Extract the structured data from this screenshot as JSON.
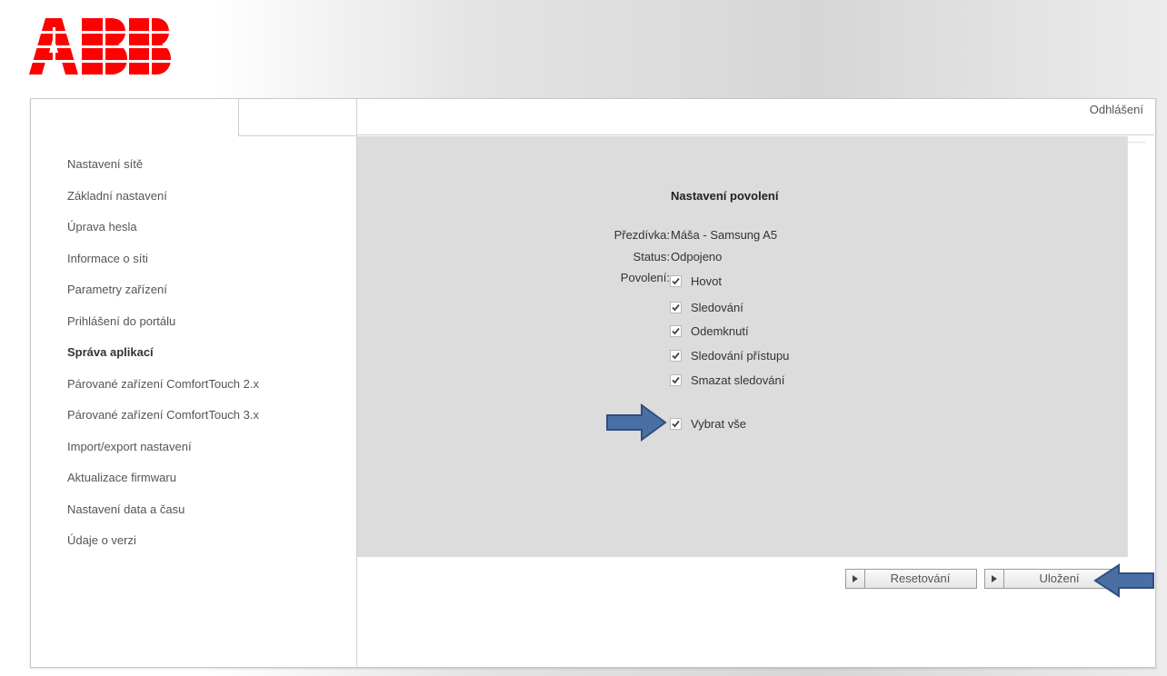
{
  "brand": {
    "logo_text": "ABB",
    "color": "#ff0000"
  },
  "header": {
    "logout_label": "Odhlášení"
  },
  "sidebar": {
    "items": [
      {
        "label": "Nastavení sítě"
      },
      {
        "label": "Základní nastavení"
      },
      {
        "label": "Úprava hesla"
      },
      {
        "label": "Informace o síti"
      },
      {
        "label": "Parametry zařízení"
      },
      {
        "label": "Prihlášení do portálu"
      },
      {
        "label": "Správa aplikací",
        "active": true
      },
      {
        "label": "Párované zařízení ComfortTouch 2.x"
      },
      {
        "label": "Párované zařízení ComfortTouch 3.x"
      },
      {
        "label": "Import/export nastavení"
      },
      {
        "label": "Aktualizace firmwaru"
      },
      {
        "label": "Nastavení data a času"
      },
      {
        "label": "Údaje o verzi"
      }
    ]
  },
  "permissions": {
    "title": "Nastavení povolení",
    "nickname_label": "Přezdívka:",
    "nickname_value": "Máša - Samsung A5",
    "status_label": "Status:",
    "status_value": "Odpojeno",
    "permissions_label": "Povolení:",
    "options": [
      {
        "label": "Hovot",
        "checked": true
      },
      {
        "label": "Sledování",
        "checked": true
      },
      {
        "label": "Odemknutí",
        "checked": true
      },
      {
        "label": "Sledování přístupu",
        "checked": true
      },
      {
        "label": "Smazat sledování",
        "checked": true
      }
    ],
    "select_all": {
      "label": "Vybrat vše",
      "checked": true
    }
  },
  "buttons": {
    "reset_label": "Resetování",
    "save_label": "Uložení"
  },
  "annotation": {
    "arrow_color": "#4a6fa5"
  }
}
